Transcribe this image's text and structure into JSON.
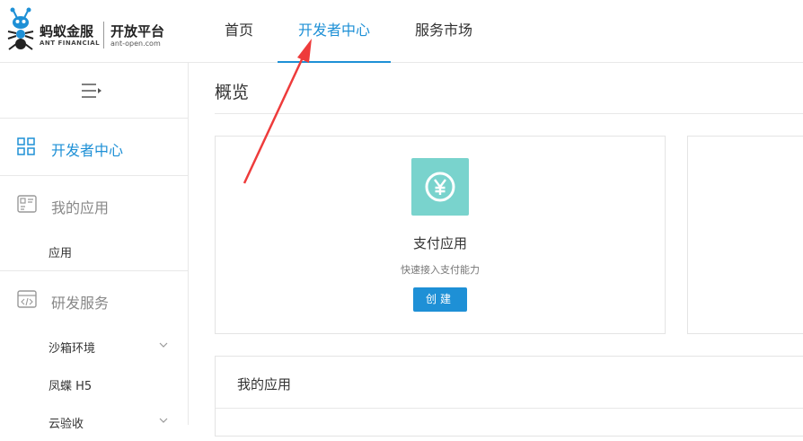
{
  "header": {
    "logo": {
      "brand_cn": "蚂蚁金服",
      "brand_en": "ANT FINANCIAL",
      "platform_cn": "开放平台",
      "platform_en": "ant-open.com"
    },
    "tabs": [
      {
        "label": "首页"
      },
      {
        "label": "开发者中心",
        "active": true
      },
      {
        "label": "服务市场"
      }
    ]
  },
  "sidebar": {
    "toggle_icon": "menu-collapse-icon",
    "groups": [
      {
        "label": "开发者中心",
        "icon": "grid-icon",
        "active": true
      },
      {
        "label": "我的应用",
        "icon": "app-icon"
      },
      {
        "label": "研发服务",
        "icon": "code-icon"
      }
    ],
    "items": [
      {
        "label": "应用"
      },
      {
        "label": "沙箱环境",
        "icon": "chevron-down-icon"
      },
      {
        "label": "凤蝶 H5"
      },
      {
        "label": "云验收",
        "icon": "chevron-down-icon"
      }
    ]
  },
  "main": {
    "page_title": "概览",
    "pay_card": {
      "icon": "yuan-icon",
      "title": "支付应用",
      "description": "快速接入支付能力",
      "create_label": "创建"
    },
    "apps_panel": {
      "title": "我的应用"
    }
  },
  "colors": {
    "accent": "#1e90d6",
    "pay_icon_bg": "#79d3cd",
    "annotation_arrow": "#ee3b3b"
  }
}
